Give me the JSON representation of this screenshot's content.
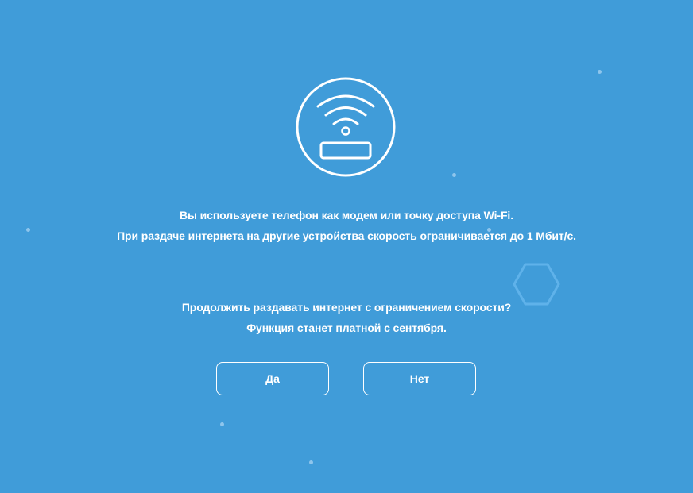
{
  "dialog": {
    "icon": "router-wifi-icon",
    "info_line_1": "Вы используете телефон как модем или точку доступа Wi-Fi.",
    "info_line_2": "При раздаче интернета на другие устройства скорость ограничивается до 1 Мбит/с.",
    "question_line_1": "Продолжить раздавать интернет с ограничением скорости?",
    "question_line_2": "Функция станет платной с сентября.",
    "yes_label": "Да",
    "no_label": "Нет"
  },
  "colors": {
    "background": "#409cd9",
    "foreground": "#ffffff",
    "decoration": "#8ec5ec"
  }
}
